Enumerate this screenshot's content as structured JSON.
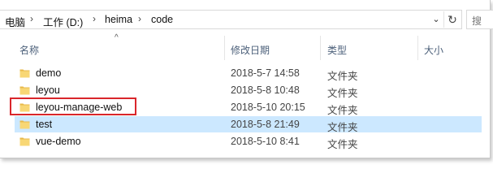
{
  "breadcrumb": {
    "items": [
      "电脑",
      "工作 (D:)",
      "heima",
      "code"
    ],
    "separator": "›"
  },
  "address_bar": {
    "dropdown_glyph": "⌄",
    "refresh_glyph": "↻"
  },
  "search": {
    "placeholder": "搜"
  },
  "columns": {
    "name": "名称",
    "modified": "修改日期",
    "type": "类型",
    "size": "大小",
    "sort_glyph": "^"
  },
  "files": [
    {
      "name": "demo",
      "modified": "2018-5-7 14:58",
      "type": "文件夹",
      "selected": false,
      "highlighted": false
    },
    {
      "name": "leyou",
      "modified": "2018-5-8 10:48",
      "type": "文件夹",
      "selected": false,
      "highlighted": false
    },
    {
      "name": "leyou-manage-web",
      "modified": "2018-5-10 20:15",
      "type": "文件夹",
      "selected": false,
      "highlighted": true
    },
    {
      "name": "test",
      "modified": "2018-5-8 21:49",
      "type": "文件夹",
      "selected": true,
      "highlighted": false
    },
    {
      "name": "vue-demo",
      "modified": "2018-5-10 8:41",
      "type": "文件夹",
      "selected": false,
      "highlighted": false
    }
  ],
  "colors": {
    "selection": "#cce8ff",
    "highlight_border": "#d9262b",
    "folder": "#f8d775"
  }
}
